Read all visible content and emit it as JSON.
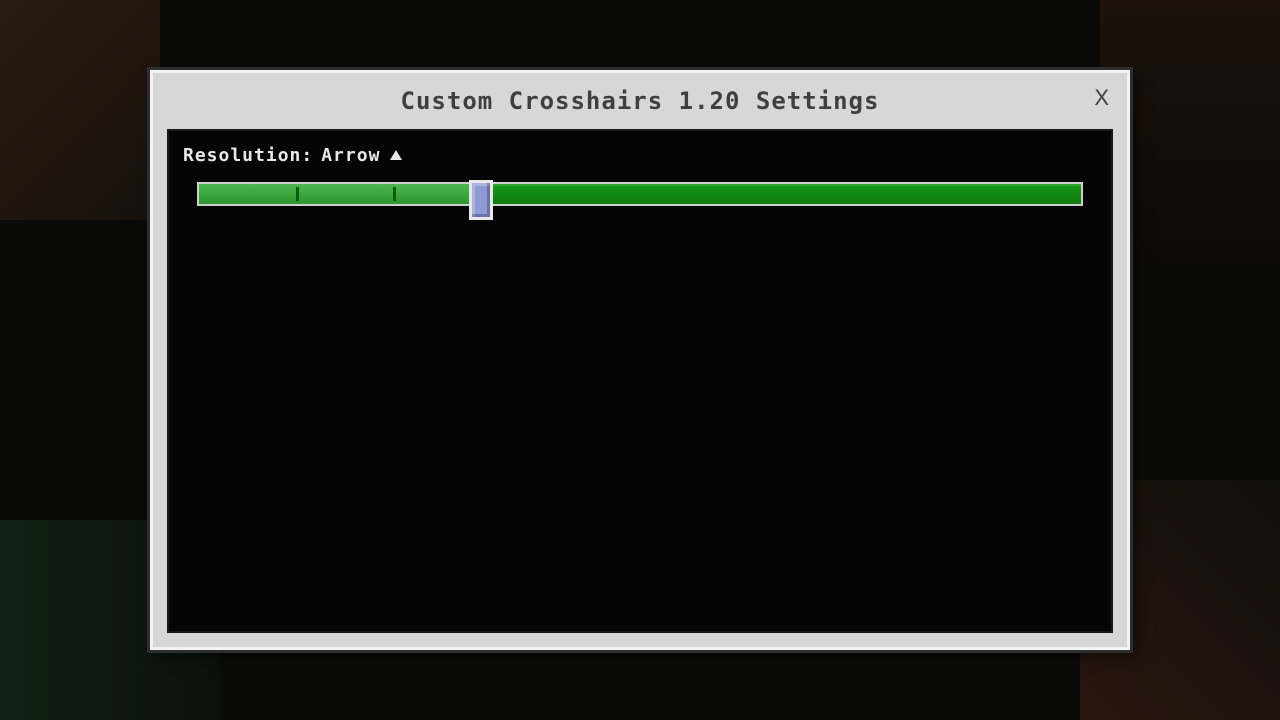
{
  "modal": {
    "title": "Custom Crosshairs 1.20 Settings",
    "close_label": "X"
  },
  "setting": {
    "label_prefix": "Resolution:",
    "value": "Arrow",
    "slider": {
      "min": 0,
      "max": 100,
      "value": 32,
      "ticks_percent": [
        11,
        22
      ],
      "colors": {
        "track": "#169a16",
        "fill": "#4fb74f",
        "thumb": "#8f9bd6",
        "border": "#cfcfcf"
      }
    }
  }
}
